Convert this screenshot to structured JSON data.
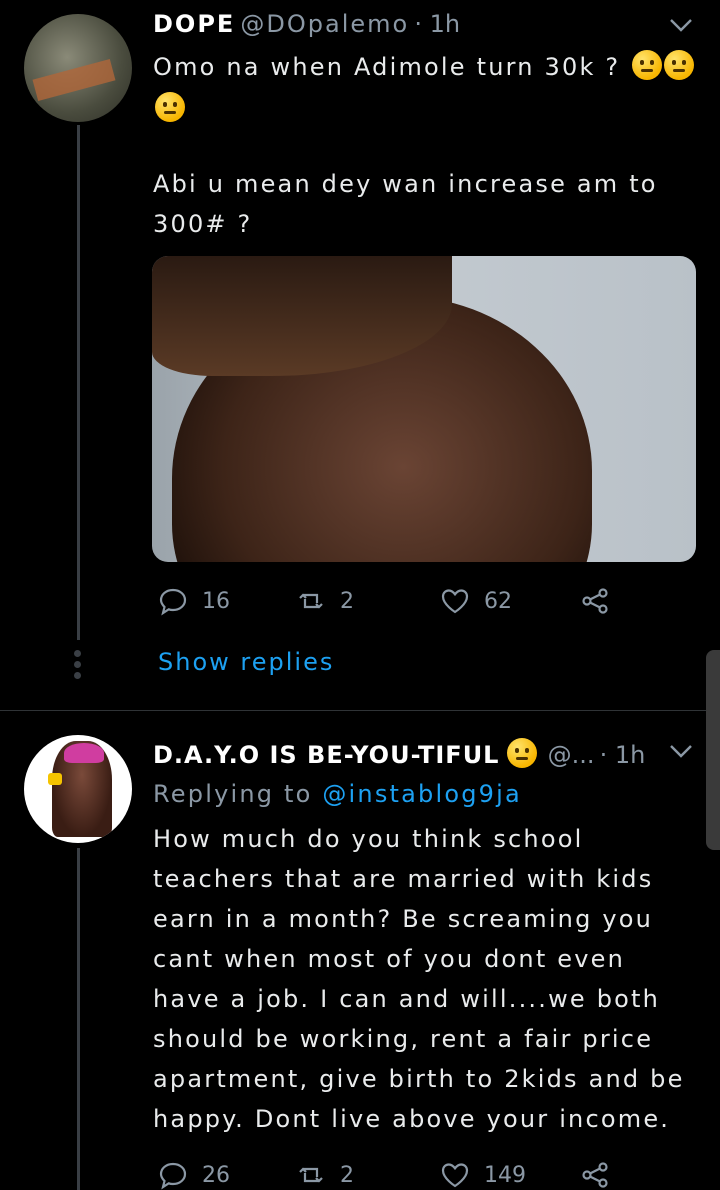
{
  "tweet1": {
    "name": "DOPE",
    "handle": "@DOpalemo",
    "time": "· 1h",
    "line1": "Omo na when Adimole turn 30k ?",
    "line3": "Abi u mean dey wan increase am to",
    "line4": "300# ?",
    "reply_count": "16",
    "retweet_count": "2",
    "like_count": "62",
    "show_replies": "Show replies"
  },
  "tweet2": {
    "name": "D.A.Y.O IS BE-YOU-TIFUL",
    "handle": "@...",
    "time": "· 1h",
    "replying_prefix": "Replying to",
    "replying_handle": "@instablog9ja",
    "lines": [
      "How much do you think school",
      "teachers that are married with kids",
      "earn in a month? Be screaming you",
      "cant when most of you dont even",
      "have a job. I can and will....we both",
      "should be working, rent a fair price",
      "apartment, give birth to 2kids and be",
      "happy. Dont live above your income."
    ],
    "reply_count": "26",
    "retweet_count": "2",
    "like_count": "149"
  },
  "icons": [
    "reply-icon",
    "retweet-icon",
    "like-icon",
    "share-icon",
    "chevron-down-icon",
    "thinking-emoji",
    "smile-emoji"
  ],
  "colors": {
    "background": "#000000",
    "accent": "#1da1f2",
    "muted": "#8b98a5",
    "divider": "#2f3336"
  }
}
